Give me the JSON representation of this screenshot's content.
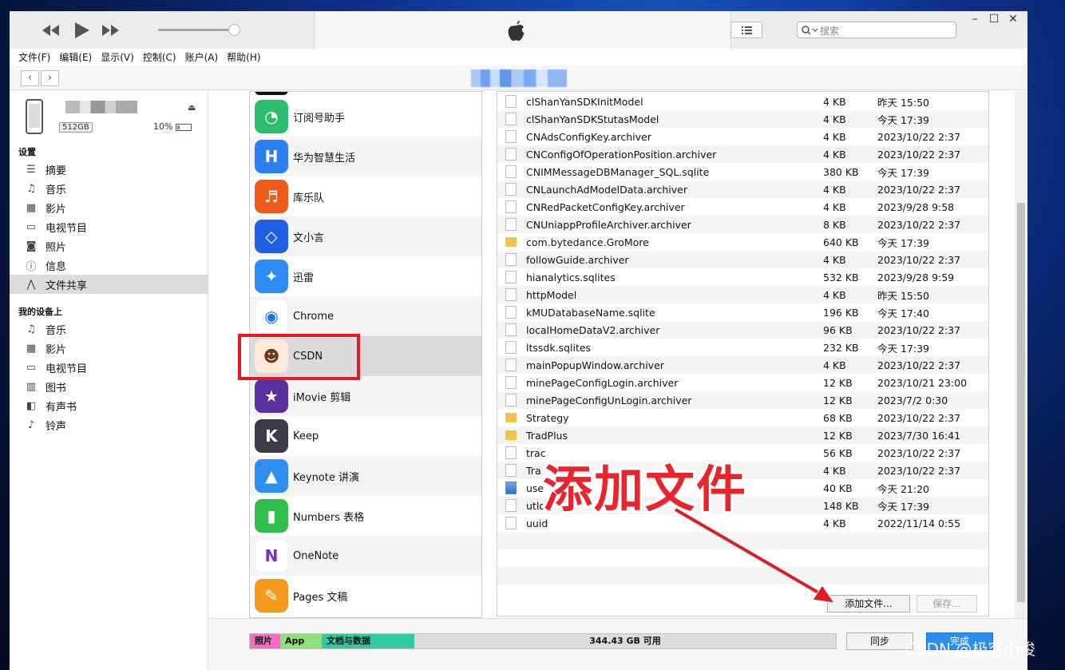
{
  "toolbar": {
    "search_placeholder": "搜索"
  },
  "menu": [
    "文件(F)",
    "编辑(E)",
    "显示(V)",
    "控制(C)",
    "账户(A)",
    "帮助(H)"
  ],
  "device": {
    "capacity": "512GB",
    "battery": "10%"
  },
  "sidebar": {
    "settings_header": "设置",
    "settings": [
      {
        "label": "摘要",
        "icon": "summary-icon"
      },
      {
        "label": "音乐",
        "icon": "music-icon"
      },
      {
        "label": "影片",
        "icon": "film-icon"
      },
      {
        "label": "电视节目",
        "icon": "tv-icon"
      },
      {
        "label": "照片",
        "icon": "camera-icon"
      },
      {
        "label": "信息",
        "icon": "info-icon"
      },
      {
        "label": "文件共享",
        "icon": "apps-icon",
        "active": true
      }
    ],
    "mydevice_header": "我的设备上",
    "mydevice": [
      {
        "label": "音乐",
        "icon": "music-icon"
      },
      {
        "label": "影片",
        "icon": "film-icon"
      },
      {
        "label": "电视节目",
        "icon": "tv-icon"
      },
      {
        "label": "图书",
        "icon": "book-icon"
      },
      {
        "label": "有声书",
        "icon": "audiobook-icon"
      },
      {
        "label": "铃声",
        "icon": "bell-icon"
      }
    ]
  },
  "apps": [
    {
      "name": "订阅号助手",
      "icon": "subscription-assistant-icon",
      "color": "#2dbd6e"
    },
    {
      "name": "华为智慧生活",
      "icon": "huawei-ai-life-icon",
      "color": "#2a7ef0"
    },
    {
      "name": "库乐队",
      "icon": "garageband-icon",
      "color": "#f05a1a"
    },
    {
      "name": "文小言",
      "icon": "wenxiaoyan-icon",
      "color": "#1f5fe0"
    },
    {
      "name": "迅雷",
      "icon": "xunlei-icon",
      "color": "#2c8cf4"
    },
    {
      "name": "Chrome",
      "icon": "chrome-icon",
      "color": "#ffffff"
    },
    {
      "name": "CSDN",
      "icon": "csdn-icon",
      "color": "#fbe9dc",
      "selected": true
    },
    {
      "name": "iMovie 剪辑",
      "icon": "imovie-icon",
      "color": "#5b2f9e"
    },
    {
      "name": "Keep",
      "icon": "keep-icon",
      "color": "#3b3b4a"
    },
    {
      "name": "Keynote 讲演",
      "icon": "keynote-icon",
      "color": "#2f8ef0"
    },
    {
      "name": "Numbers 表格",
      "icon": "numbers-icon",
      "color": "#2fbe4c"
    },
    {
      "name": "OneNote",
      "icon": "onenote-icon",
      "color": "#ffffff"
    },
    {
      "name": "Pages 文稿",
      "icon": "pages-icon",
      "color": "#f59a1c"
    }
  ],
  "files": [
    {
      "name": "clShanYanSDKInitModel",
      "size": "4 KB",
      "date": "昨天 15:50",
      "type": "file"
    },
    {
      "name": "clShanYanSDKStutasModel",
      "size": "4 KB",
      "date": "今天 17:39",
      "type": "file"
    },
    {
      "name": "CNAdsConfigKey.archiver",
      "size": "4 KB",
      "date": "2023/10/22 2:37",
      "type": "file"
    },
    {
      "name": "CNConfigOfOperationPosition.archiver",
      "size": "4 KB",
      "date": "2023/10/22 2:37",
      "type": "file"
    },
    {
      "name": "CNIMMessageDBManager_SQL.sqlite",
      "size": "380 KB",
      "date": "今天 17:39",
      "type": "file"
    },
    {
      "name": "CNLaunchAdModelData.archiver",
      "size": "4 KB",
      "date": "2023/10/22 2:37",
      "type": "file"
    },
    {
      "name": "CNRedPacketConfigKey.archiver",
      "size": "4 KB",
      "date": "2023/9/28 9:58",
      "type": "file"
    },
    {
      "name": "CNUniappProfileArchiver.archiver",
      "size": "8 KB",
      "date": "2023/10/22 2:37",
      "type": "file"
    },
    {
      "name": "com.bytedance.GroMore",
      "size": "640 KB",
      "date": "今天 17:39",
      "type": "folder"
    },
    {
      "name": "followGuide.archiver",
      "size": "4 KB",
      "date": "2023/10/22 2:37",
      "type": "file"
    },
    {
      "name": "hianalytics.sqlites",
      "size": "532 KB",
      "date": "2023/9/28 9:59",
      "type": "file"
    },
    {
      "name": "httpModel",
      "size": "4 KB",
      "date": "昨天 15:50",
      "type": "file"
    },
    {
      "name": "kMUDatabaseName.sqlite",
      "size": "196 KB",
      "date": "今天 17:40",
      "type": "file"
    },
    {
      "name": "localHomeDataV2.archiver",
      "size": "96 KB",
      "date": "2023/10/22 2:37",
      "type": "file"
    },
    {
      "name": "ltssdk.sqlites",
      "size": "232 KB",
      "date": "今天 17:39",
      "type": "file"
    },
    {
      "name": "mainPopupWindow.archiver",
      "size": "4 KB",
      "date": "2023/10/22 2:37",
      "type": "file"
    },
    {
      "name": "minePageConfigLogin.archiver",
      "size": "12 KB",
      "date": "2023/10/21 23:00",
      "type": "file"
    },
    {
      "name": "minePageConfigUnLogin.archiver",
      "size": "12 KB",
      "date": "2023/7/2 0:30",
      "type": "file"
    },
    {
      "name": "Strategy",
      "size": "68 KB",
      "date": "2023/10/22 2:37",
      "type": "folder"
    },
    {
      "name": "TradPlus",
      "size": "12 KB",
      "date": "2023/7/30 16:41",
      "type": "folder"
    },
    {
      "name": "trac",
      "size": "56 KB",
      "date": "2023/10/22 2:37",
      "type": "file"
    },
    {
      "name": "Tra",
      "size": "4 KB",
      "date": "2023/10/22 2:37",
      "type": "file"
    },
    {
      "name": "use",
      "size": "40 KB",
      "date": "今天 21:20",
      "type": "image"
    },
    {
      "name": "utlo",
      "size": "148 KB",
      "date": "今天 17:39",
      "type": "file"
    },
    {
      "name": "uuid",
      "size": "4 KB",
      "date": "2022/11/14 0:55",
      "type": "file"
    }
  ],
  "buttons": {
    "add_file": "添加文件...",
    "save": "保存...",
    "sync": "同步",
    "done": "完成"
  },
  "overlay_text": "添加文件",
  "storage": {
    "photos": "照片",
    "apps": "App",
    "docs": "文档与数据",
    "free": "344.43 GB 可用"
  },
  "watermark": "CSDN @极客小俊"
}
